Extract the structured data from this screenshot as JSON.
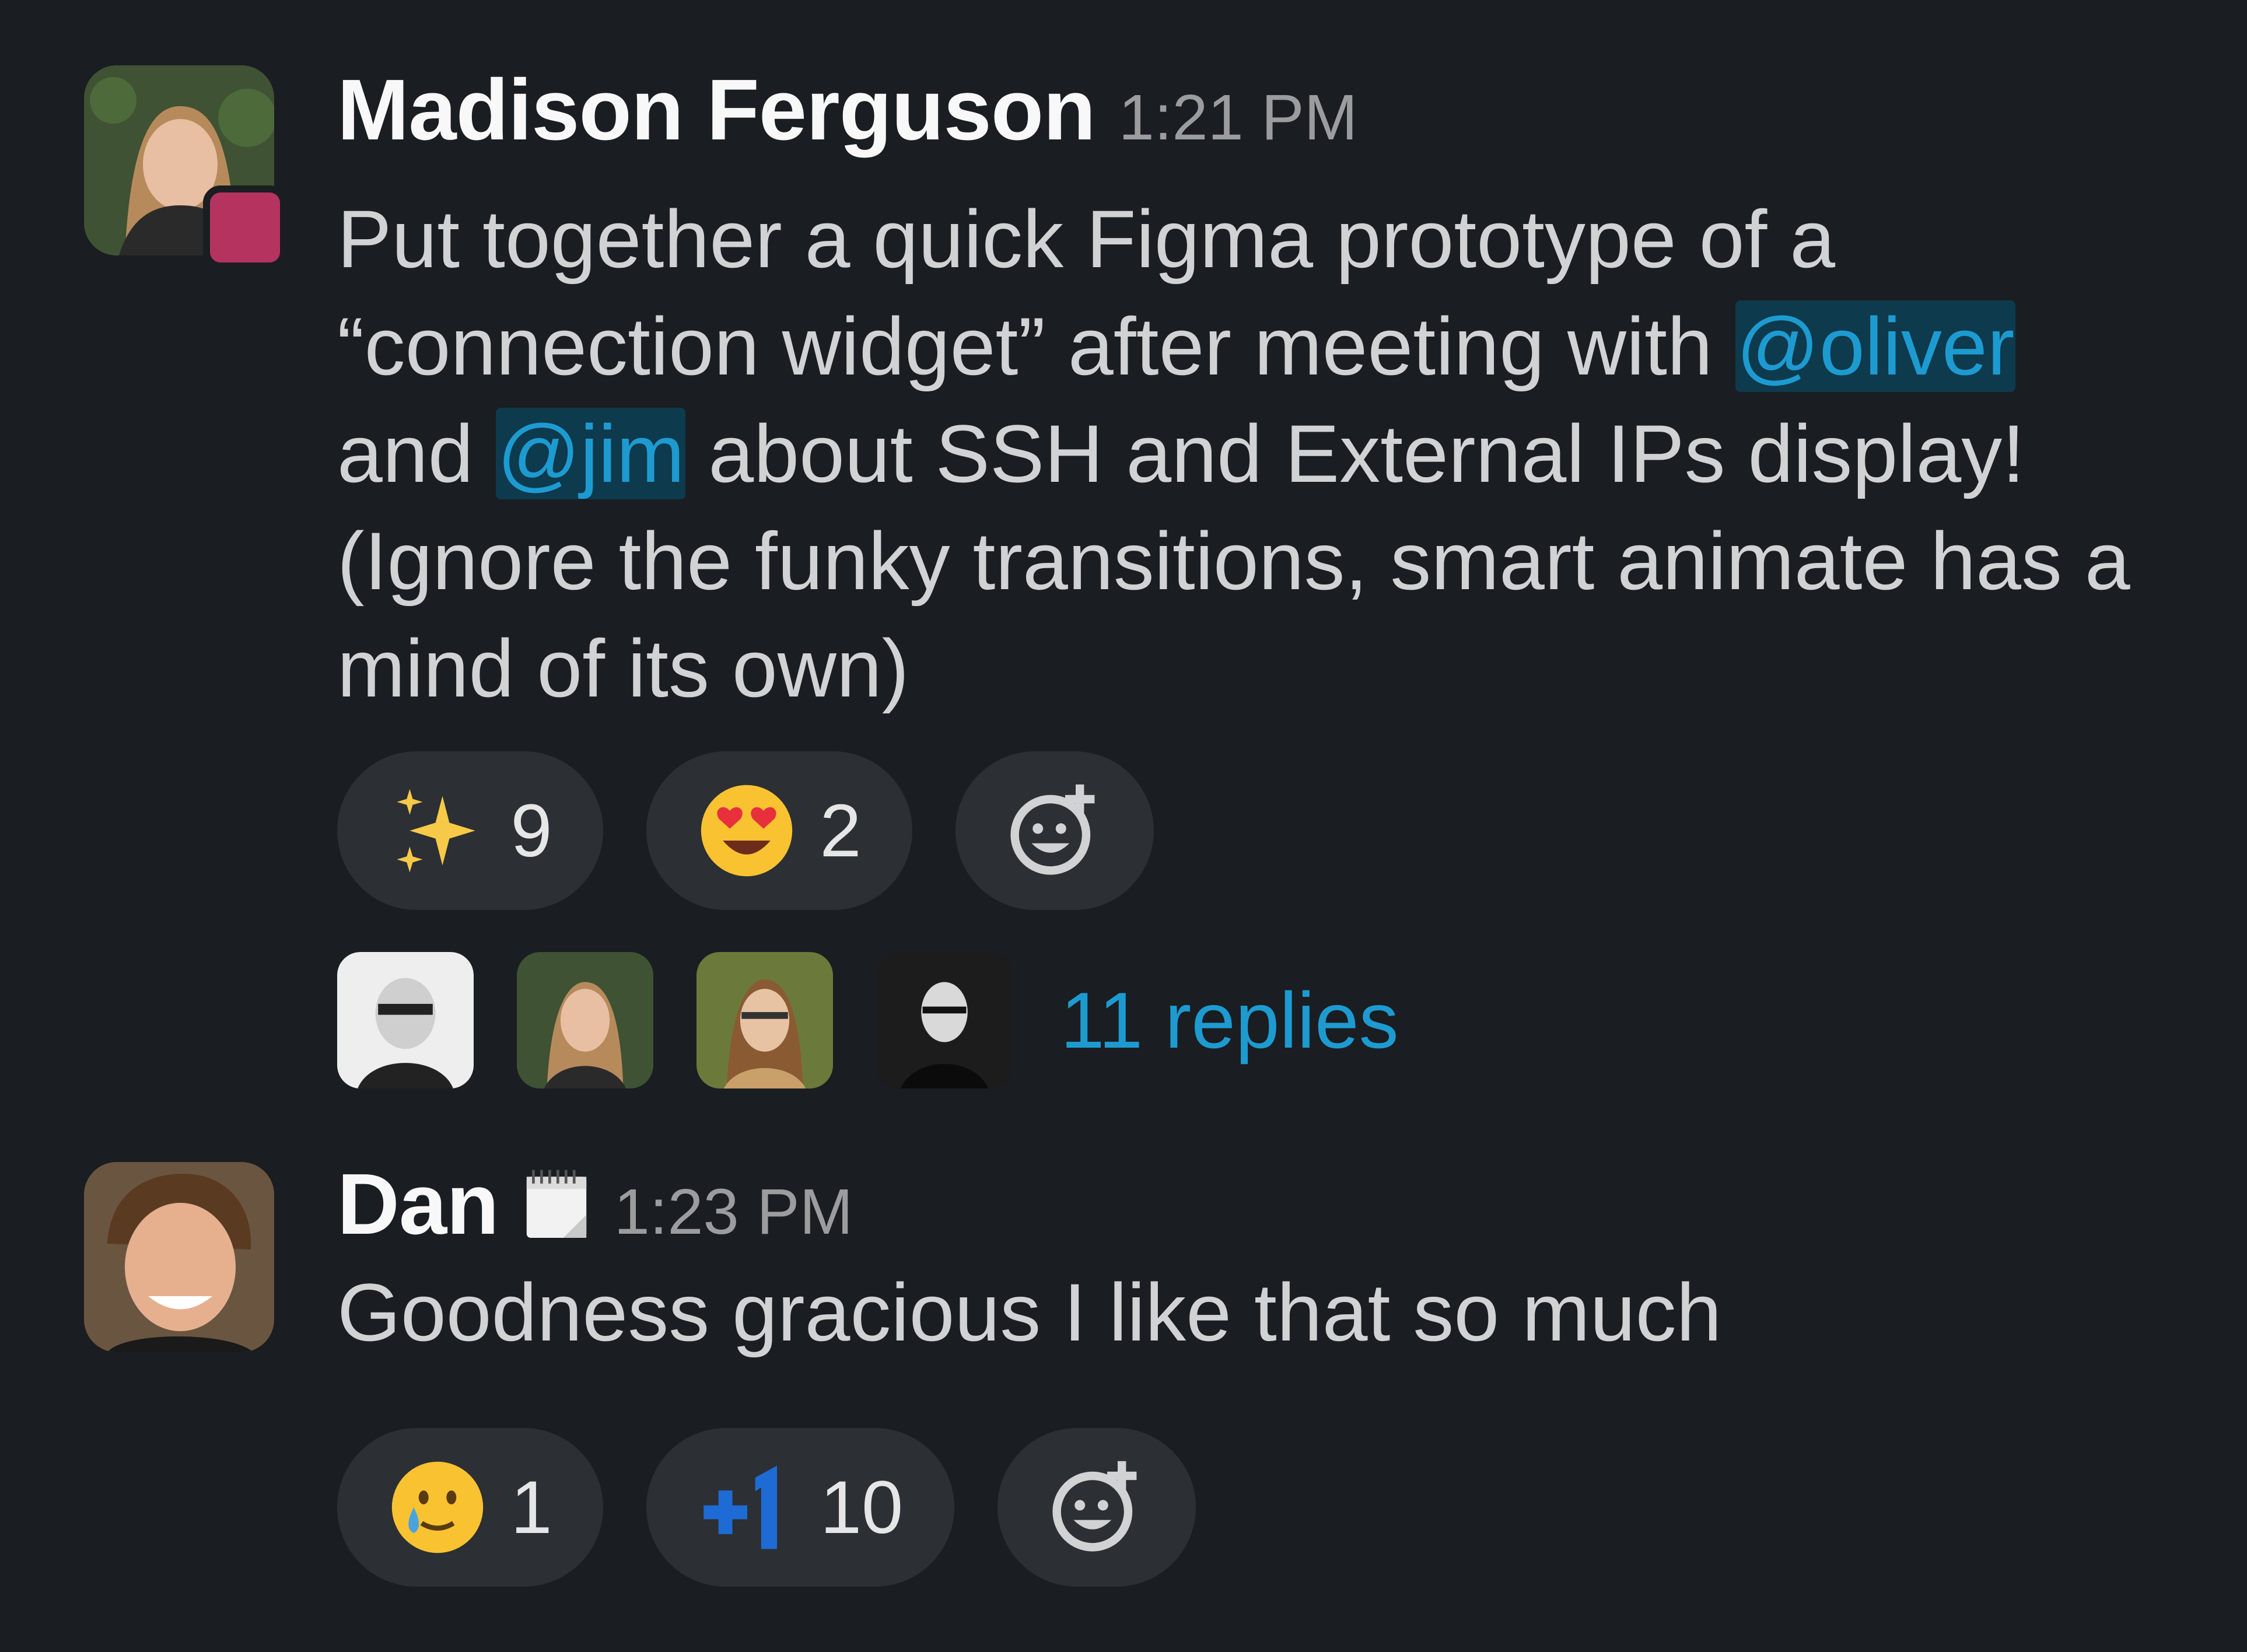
{
  "messages": [
    {
      "sender": "Madison Ferguson",
      "time": "1:21 PM",
      "text_before": "Put together a quick Figma prototype of a “connection widget” after meeting with ",
      "mention1": "@oliver",
      "text_middle": " and ",
      "mention2": "@jim",
      "text_after": " about SSH and External IPs display! (Ignore the funky transitions, smart animate has a mind of its own)",
      "reactions": [
        {
          "emoji": "sparkles-icon",
          "count": "9"
        },
        {
          "emoji": "heart-eyes-icon",
          "count": "2"
        }
      ],
      "thread": {
        "reply_count_label": "11 replies"
      }
    },
    {
      "sender": "Dan",
      "time": "1:23 PM",
      "text": "Goodness gracious I like that so much",
      "reactions": [
        {
          "emoji": "tear-smile-icon",
          "count": "1"
        },
        {
          "emoji": "plus-one-icon",
          "count": "10"
        }
      ]
    }
  ],
  "colors": {
    "background": "#1a1d21",
    "mention": "#1d9bd1",
    "mention_bg": "#0e3a4d",
    "reaction_bg": "#2c2f33",
    "status_badge": "#b5345f"
  }
}
